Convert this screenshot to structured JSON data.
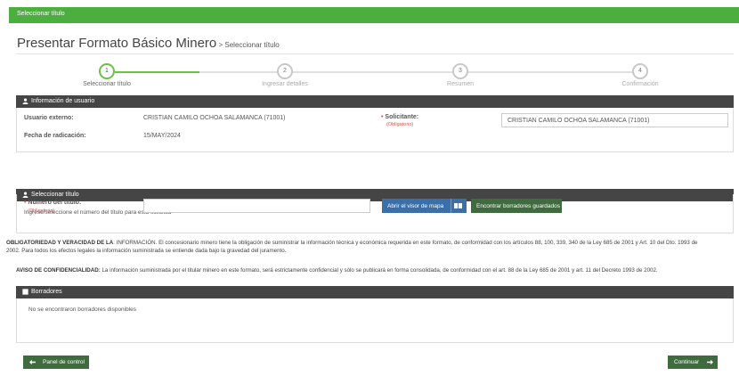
{
  "topbar": {
    "title": "Seleccionar título"
  },
  "header": {
    "title": "Presentar Formato Básico Minero",
    "subtitle": " > Seleccionar título"
  },
  "steps": [
    {
      "number": "1",
      "label": "Seleccionar título",
      "active": true
    },
    {
      "number": "2",
      "label": "Ingresar detalles",
      "active": false
    },
    {
      "number": "3",
      "label": "Resumen",
      "active": false
    },
    {
      "number": "4",
      "label": "Confirmación",
      "active": false
    }
  ],
  "user_panel": {
    "title": "Información de usuario",
    "external_user_label": "Usuario externo:",
    "external_user_value": "CRISTIAN CAMILO OCHOA SALAMANCA (71001)",
    "filing_date_label": "Fecha de radicación:",
    "filing_date_value": "15/MAY/2024",
    "requester_label": "Solicitante:",
    "requester_required": "(Obligatorio)",
    "requester_value": "CRISTIAN CAMILO OCHOA SALAMANCA (71001)"
  },
  "title_panel": {
    "title": "Seleccionar título",
    "instruction": "Ingrese/seleccione el número del título para esta solicitud",
    "number_label": "Número del título:",
    "number_required": "(Obligatorio)",
    "number_value": "",
    "map_button": "Abrir el visor de mapa",
    "drafts_button": "Encontrar borradores guardados"
  },
  "notices": {
    "obligation_heading": "OBLIGATORIEDAD Y VERACIDAD DE LA",
    "obligation_text_1": ": INFORMACIÓN. El concesionario minero tiene la obligación de suministrar la información técnica y económica requerida en este formato, de conformidad con los artículos 88, 100, 339, 340 de la Ley 685 de 2001 y Art. 10 del Dto. 1993 de",
    "obligation_text_2": "2002. Para todos los efectos legales la información suministrada se entiende dada bajo la gravedad del juramento.",
    "privacy_heading": "AVISO DE CONFIDENCIALIDAD:",
    "privacy_text": " La información suministrada por el titular minero en este formato, será estrictamente confidencial y sólo se publicará en forma consolidada, de conformidad con el art. 88 de la Ley 685 de 2001 y art. 11 del Decreto 1993 de 2002."
  },
  "drafts_panel": {
    "title": "Borradores",
    "empty_message": "No se encontraron borradores disponibles"
  },
  "footer": {
    "back_button": "Panel de control",
    "continue_button": "Continuar"
  },
  "colors": {
    "green": "#4cae3f",
    "dark": "#454545",
    "blue": "#3b6fa8",
    "required": "#d9534f"
  }
}
